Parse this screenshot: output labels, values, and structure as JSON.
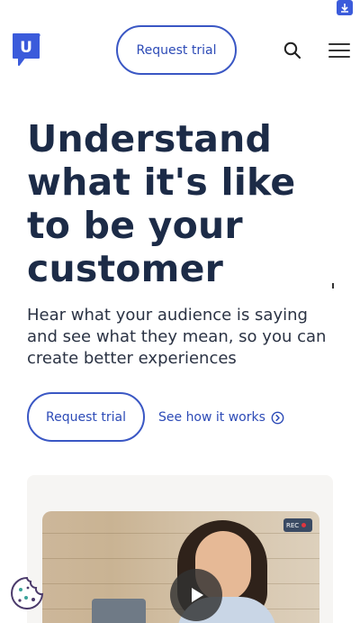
{
  "header": {
    "logo_letter": "U",
    "cta_label": "Request trial"
  },
  "hero": {
    "title": "Understand what it's like to be your customer",
    "subtitle": "Hear what your audience is saying and see what they mean, so you can create better experiences",
    "primary_cta": "Request trial",
    "secondary_link": "See how it works"
  },
  "video": {
    "rec_label": "REC"
  },
  "icons": {
    "top_badge": "download-icon",
    "search": "search-icon",
    "menu": "hamburger-menu-icon",
    "arrow": "circle-arrow-right-icon",
    "play": "play-icon",
    "cookie": "cookie-icon"
  },
  "colors": {
    "brand_blue": "#3a57c4",
    "heading": "#1c2b47",
    "text": "#2b3344"
  }
}
